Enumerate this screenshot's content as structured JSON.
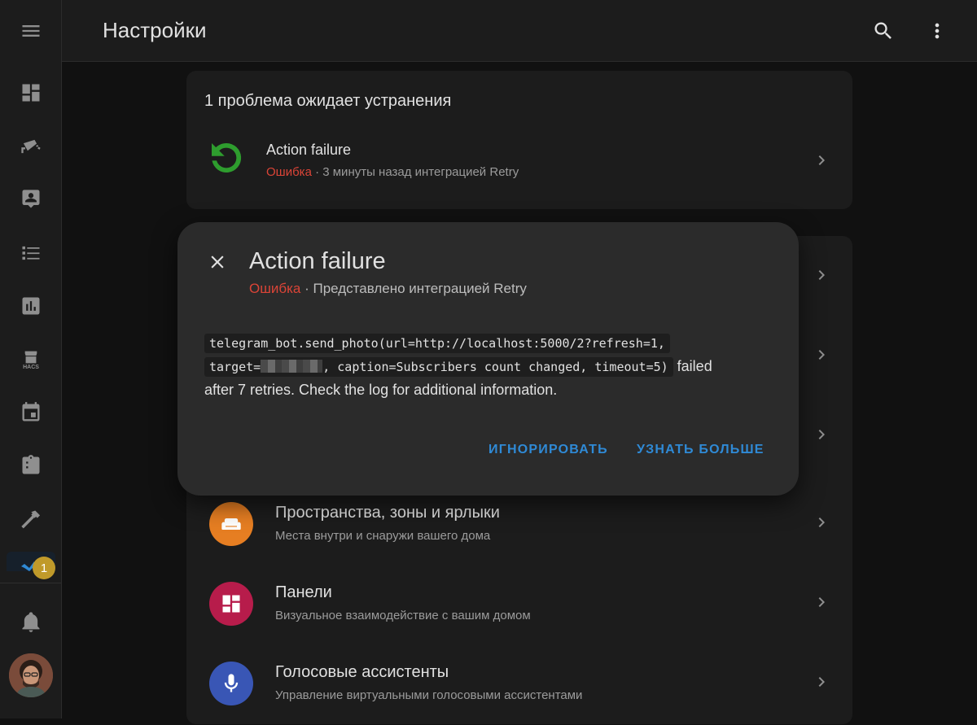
{
  "header": {
    "title": "Настройки"
  },
  "sidebar": {
    "items": [
      {
        "icon": "menu-icon"
      },
      {
        "icon": "dashboard-icon"
      },
      {
        "icon": "cctv-icon"
      },
      {
        "icon": "account-box-icon"
      },
      {
        "icon": "format-list-checks-icon"
      },
      {
        "icon": "chart-box-icon"
      },
      {
        "icon": "hacs-store-icon",
        "label": "HACS"
      },
      {
        "icon": "calendar-icon"
      },
      {
        "icon": "clipboard-list-icon"
      },
      {
        "icon": "hammer-icon"
      },
      {
        "icon": "vscode-icon"
      }
    ],
    "badge": "1",
    "bottom": [
      {
        "icon": "bell-icon"
      },
      {
        "icon": "avatar"
      }
    ]
  },
  "repairs": {
    "title": "1 проблема ожидает устранения",
    "item": {
      "title": "Action failure",
      "status": "Ошибка",
      "meta": " · 3 минуты назад интеграцией Retry"
    }
  },
  "menu": [
    {
      "title": "Пространства, зоны и ярлыки",
      "subtitle": "Места внутри и снаружи вашего дома",
      "color": "#e67e22",
      "icon": "sofa-icon"
    },
    {
      "title": "Панели",
      "subtitle": "Визуальное взаимодействие с вашим домом",
      "color": "#b71c4b",
      "icon": "view-dashboard-icon"
    },
    {
      "title": "Голосовые ассистенты",
      "subtitle": "Управление виртуальными голосовыми ассистентами",
      "color": "#3956b5",
      "icon": "microphone-icon"
    }
  ],
  "dialog": {
    "title": "Action failure",
    "status": "Ошибка",
    "meta": " · Представлено интеграцией Retry",
    "code_line1": "telegram_bot.send_photo(url=http://localhost:5000/2?refresh=1,",
    "code_line2_a": "target=",
    "code_line2_b": ", caption=Subscribers count changed, timeout=5)",
    "text_after": " failed",
    "text_line3": "after 7 retries. Check the log for additional information.",
    "ignore_label": "ИГНОРИРОВАТЬ",
    "learn_more_label": "УЗНАТЬ БОЛЬШЕ"
  }
}
